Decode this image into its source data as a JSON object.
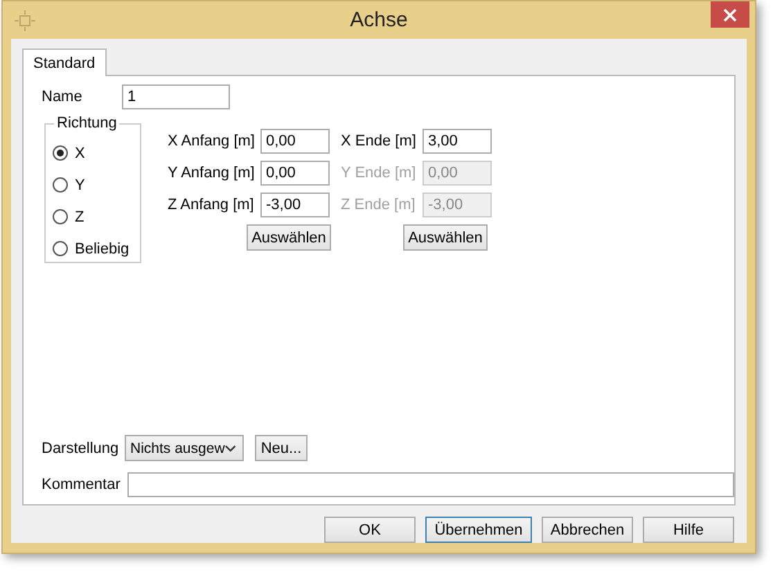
{
  "window": {
    "title": "Achse"
  },
  "tabs": [
    {
      "label": "Standard",
      "selected": true
    }
  ],
  "name": {
    "label": "Name",
    "value": "1"
  },
  "direction": {
    "title": "Richtung",
    "options": [
      {
        "label": "X",
        "selected": true
      },
      {
        "label": "Y",
        "selected": false
      },
      {
        "label": "Z",
        "selected": false
      },
      {
        "label": "Beliebig",
        "selected": false
      }
    ]
  },
  "coordinates": [
    {
      "start": {
        "label": "X Anfang [m]",
        "value": "0,00",
        "disabled": false
      },
      "end": {
        "label": "X Ende [m]",
        "value": "3,00",
        "disabled": false
      }
    },
    {
      "start": {
        "label": "Y Anfang [m]",
        "value": "0,00",
        "disabled": false
      },
      "end": {
        "label": "Y Ende [m]",
        "value": "0,00",
        "disabled": true
      }
    },
    {
      "start": {
        "label": "Z Anfang [m]",
        "value": "-3,00",
        "disabled": false
      },
      "end": {
        "label": "Z Ende [m]",
        "value": "-3,00",
        "disabled": true
      }
    }
  ],
  "select_buttons": [
    "Auswählen",
    "Auswählen"
  ],
  "display": {
    "label": "Darstellung",
    "value": "Nichts ausgew",
    "button": "Neu..."
  },
  "comment": {
    "label": "Kommentar"
  },
  "buttons": [
    {
      "label": "OK",
      "focused": false
    },
    {
      "label": "Übernehmen",
      "focused": true
    },
    {
      "label": "Abbrechen",
      "focused": false
    },
    {
      "label": "Hilfe",
      "focused": false
    }
  ]
}
